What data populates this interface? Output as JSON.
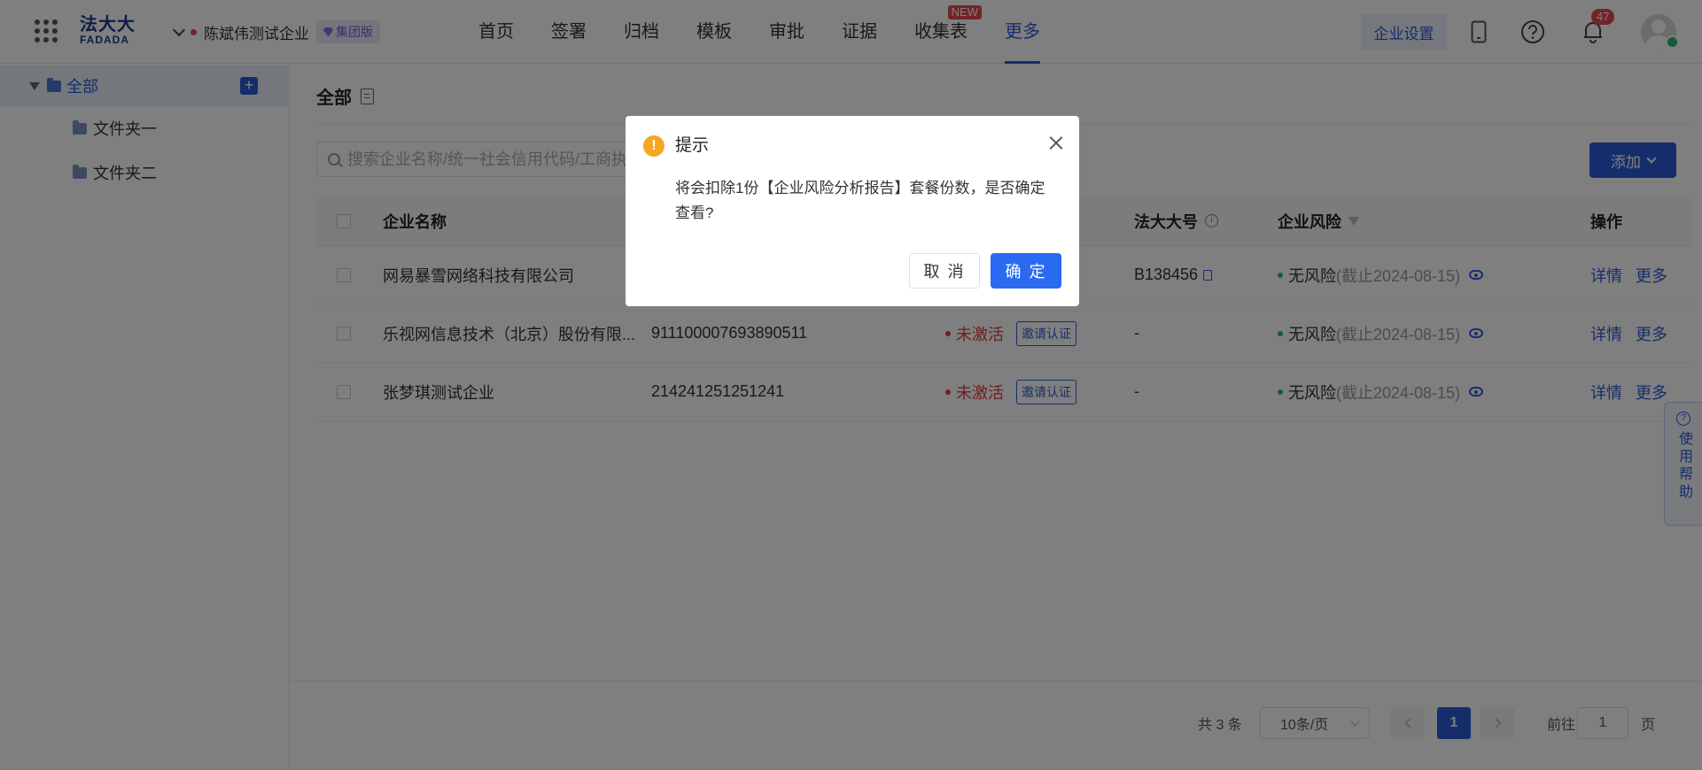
{
  "header": {
    "logo_cn": "法大大",
    "logo_en": "FADADA",
    "company": "陈斌伟测试企业",
    "company_badge": "集团版",
    "nav": [
      {
        "label": "首页"
      },
      {
        "label": "签署"
      },
      {
        "label": "归档"
      },
      {
        "label": "模板"
      },
      {
        "label": "审批"
      },
      {
        "label": "证据"
      },
      {
        "label": "收集表",
        "tag": "NEW"
      },
      {
        "label": "更多",
        "active": true
      }
    ],
    "enterprise_settings": "企业设置",
    "notification_count": "47"
  },
  "sidebar": {
    "root": "全部",
    "folders": [
      "文件夹一",
      "文件夹二"
    ]
  },
  "main": {
    "title": "全部",
    "search_placeholder": "搜索企业名称/统一社会信用代码/工商执照号",
    "add_button": "添加",
    "columns": {
      "name": "企业名称",
      "legal_account": "法大大号",
      "risk": "企业风险",
      "actions": "操作"
    },
    "rows": [
      {
        "name": "网易暴雪网络科技有限公司",
        "code": "",
        "status": "",
        "invite": "",
        "account": "B138456",
        "risk": "无风险",
        "risk_date": "(截止2024-08-15)",
        "detail": "详情",
        "more": "更多"
      },
      {
        "name": "乐视网信息技术（北京）股份有限...",
        "code": "911100007693890511",
        "status": "未激活",
        "invite": "邀请认证",
        "account": "-",
        "risk": "无风险",
        "risk_date": "(截止2024-08-15)",
        "detail": "详情",
        "more": "更多"
      },
      {
        "name": "张梦琪测试企业",
        "code": "214241251251241",
        "status": "未激活",
        "invite": "邀请认证",
        "account": "-",
        "risk": "无风险",
        "risk_date": "(截止2024-08-15)",
        "detail": "详情",
        "more": "更多"
      }
    ],
    "help_tab": "使用帮助"
  },
  "pagination": {
    "total": "共 3 条",
    "page_size": "10条/页",
    "current_page": "1",
    "goto_label": "前往",
    "goto_value": "1",
    "page_unit": "页"
  },
  "modal": {
    "title": "提示",
    "message": "将会扣除1份【企业风险分析报告】套餐份数，是否确定查看?",
    "cancel": "取 消",
    "confirm": "确 定"
  },
  "colors": {
    "primary": "#2a5bd7",
    "danger": "#e13c3c",
    "success": "#2bb673",
    "warning": "#f5a623",
    "overlay": "rgba(0,0,0,0.5)"
  },
  "icons": [
    "apps-grid-icon",
    "chevron-down-icon",
    "diamond-icon",
    "phone-icon",
    "help-icon",
    "bell-icon",
    "folder-icon",
    "plus-icon",
    "document-icon",
    "search-icon",
    "info-icon",
    "filter-icon",
    "copy-icon",
    "eye-icon",
    "warning-icon",
    "close-icon"
  ]
}
